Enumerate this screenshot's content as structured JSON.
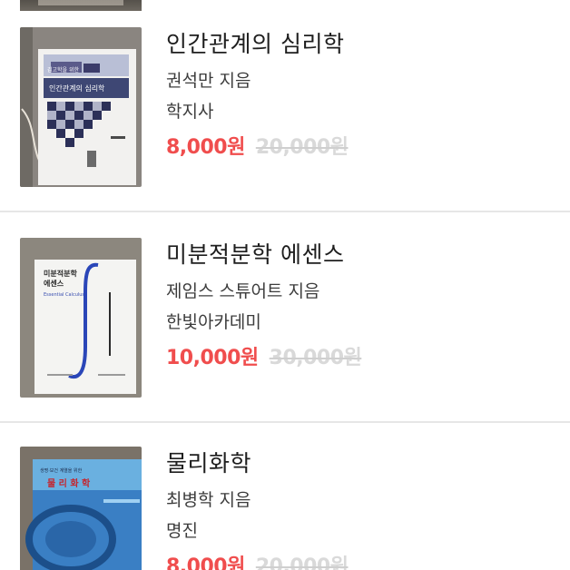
{
  "listing": {
    "items": [
      {
        "title": "인간관계의 심리학",
        "author": "권석만 지음",
        "publisher": "학지사",
        "price": "8,000원",
        "original_price": "20,000원",
        "cover_text": "인간관계의 심리학",
        "cover_text_small": "김고학을 위한"
      },
      {
        "title": "미분적분학 에센스",
        "author": "제임스 스튜어트 지음",
        "publisher": "한빛아카데미",
        "price": "10,000원",
        "original_price": "30,000원",
        "cover_text": "미분적분학",
        "cover_text_2": "에센스",
        "cover_text_en": "Essential Calculus"
      },
      {
        "title": "물리화학",
        "author": "최병학 지음",
        "publisher": "명진",
        "price": "8,000원",
        "original_price": "20,000원",
        "cover_text": "물 리 화 학",
        "cover_text_small": "생명·보건 계열을 위한"
      }
    ]
  },
  "colors": {
    "price": "#f04d4d",
    "original_price": "#d9d9d9",
    "divider": "#e6e6e6",
    "title": "#1e1e1e"
  }
}
